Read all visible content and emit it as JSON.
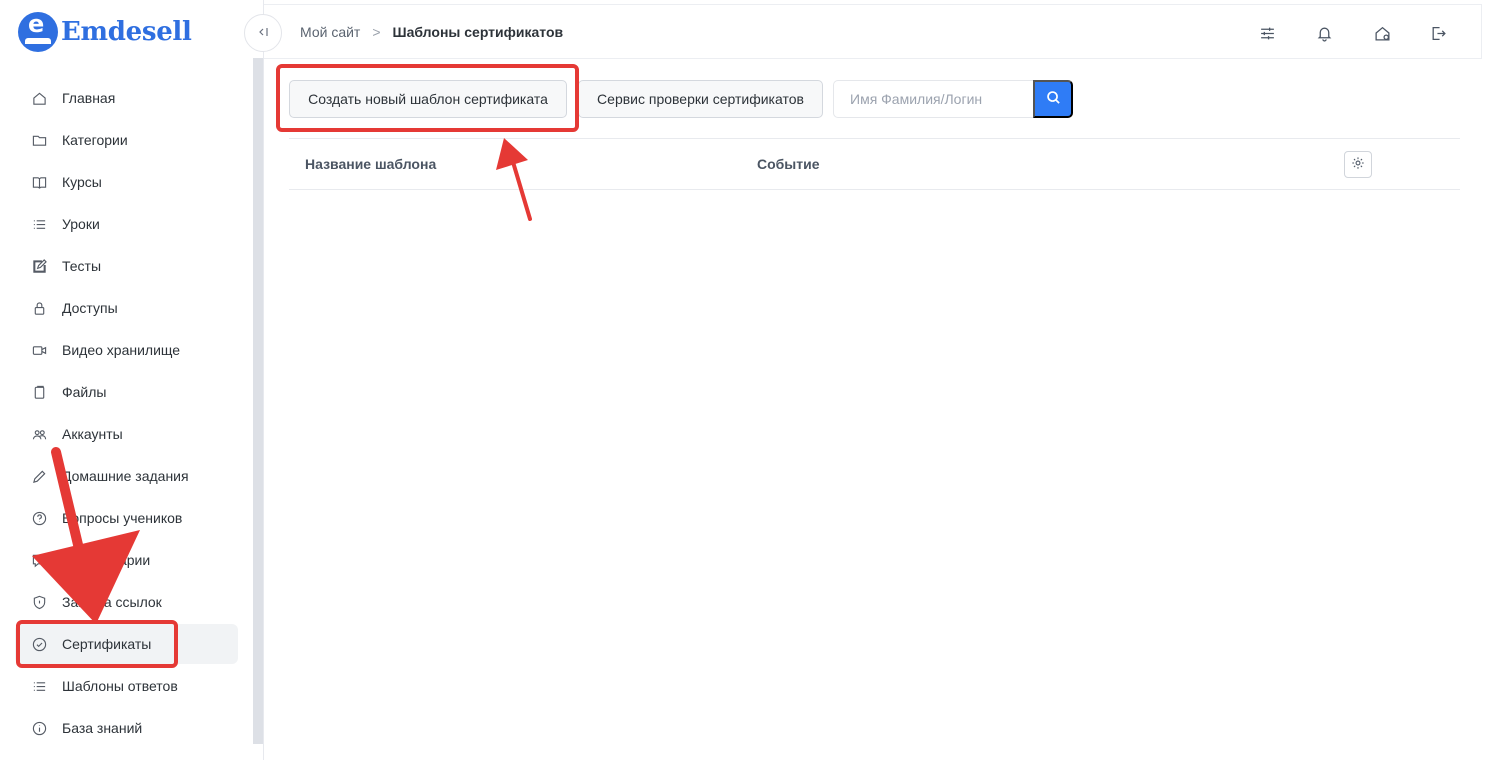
{
  "app": {
    "brand": "Emdesell",
    "logo_letter": "e"
  },
  "sidebar": {
    "items": [
      {
        "label": "Главная",
        "icon": "home-icon"
      },
      {
        "label": "Категории",
        "icon": "folder-icon"
      },
      {
        "label": "Курсы",
        "icon": "book-icon"
      },
      {
        "label": "Уроки",
        "icon": "list-icon"
      },
      {
        "label": "Тесты",
        "icon": "edit-icon"
      },
      {
        "label": "Доступы",
        "icon": "lock-icon"
      },
      {
        "label": "Видео хранилище",
        "icon": "video-icon"
      },
      {
        "label": "Файлы",
        "icon": "files-icon"
      },
      {
        "label": "Аккаунты",
        "icon": "users-icon"
      },
      {
        "label": "Домашние задания",
        "icon": "pencil-icon"
      },
      {
        "label": "Вопросы учеников",
        "icon": "question-icon"
      },
      {
        "label": "Комментарии",
        "icon": "comment-icon"
      },
      {
        "label": "Защита ссылок",
        "icon": "shield-icon"
      },
      {
        "label": "Сертификаты",
        "icon": "check-circle-icon",
        "active": true
      },
      {
        "label": "Шаблоны ответов",
        "icon": "list-icon"
      },
      {
        "label": "База знаний",
        "icon": "info-icon"
      }
    ]
  },
  "header": {
    "collapse_icon": "collapse-icon",
    "breadcrumb": {
      "root": "Мой сайт",
      "separator": ">",
      "current": "Шаблоны сертификатов"
    },
    "icons": [
      "sliders-icon",
      "bell-icon",
      "home-settings-icon",
      "logout-icon"
    ]
  },
  "toolbar": {
    "create_label": "Создать новый шаблон сертификата",
    "verify_label": "Сервис проверки сертификатов",
    "search_placeholder": "Имя Фамилия/Логин",
    "search_value": ""
  },
  "table": {
    "columns": [
      "Название шаблона",
      "Событие"
    ],
    "rows": []
  },
  "annotations": {
    "color": "#e53935"
  }
}
